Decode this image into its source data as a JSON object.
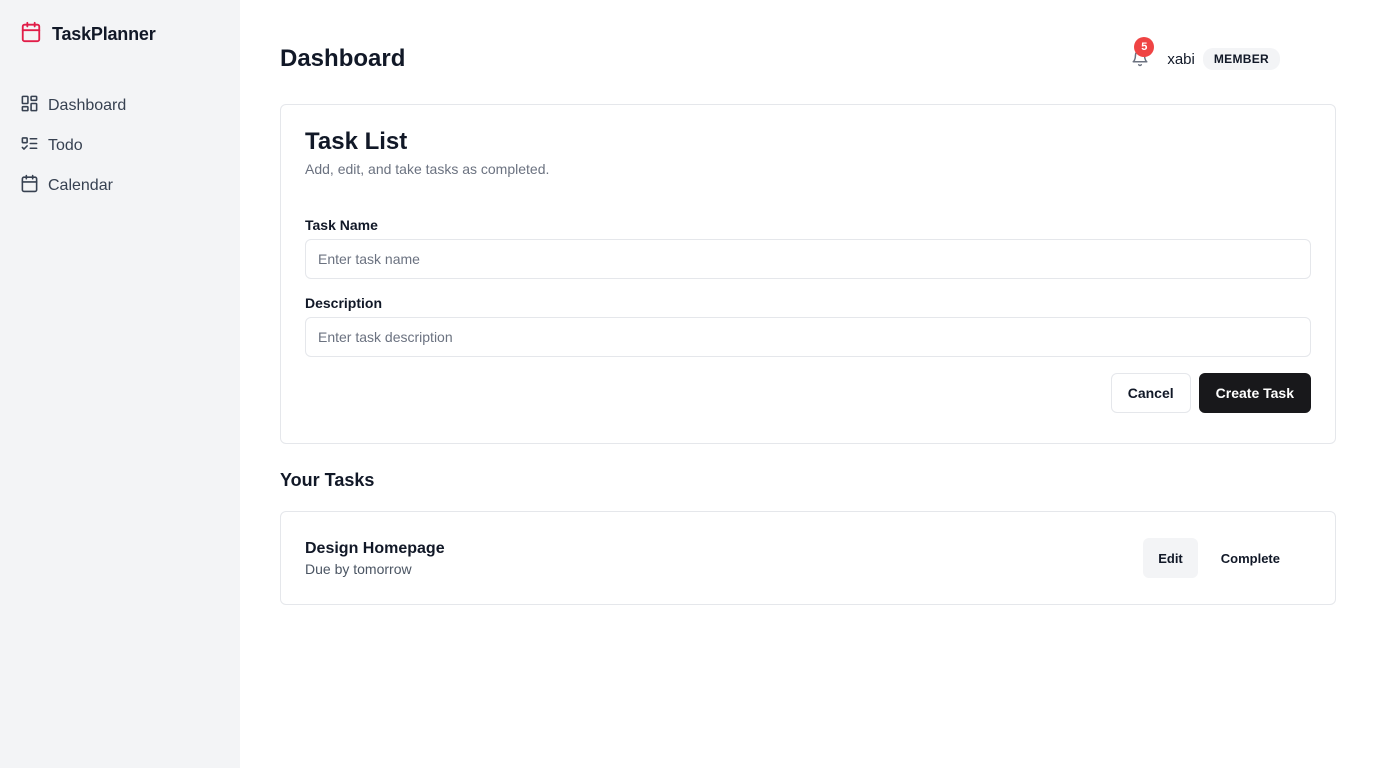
{
  "brand": {
    "name": "TaskPlanner",
    "icon": "calendar-icon",
    "color": "#e11d48"
  },
  "sidebar": {
    "items": [
      {
        "label": "Dashboard",
        "icon": "dashboard-grid-icon"
      },
      {
        "label": "Todo",
        "icon": "checklist-icon"
      },
      {
        "label": "Calendar",
        "icon": "calendar-icon"
      }
    ]
  },
  "header": {
    "title": "Dashboard",
    "notifications": {
      "count": "5",
      "icon": "bell-icon",
      "badge_color": "#ef4444"
    },
    "user": {
      "name": "xabi",
      "role": "MEMBER"
    }
  },
  "task_form": {
    "title": "Task List",
    "subtitle": "Add, edit, and take tasks as completed.",
    "name_label": "Task Name",
    "name_placeholder": "Enter task name",
    "name_value": "",
    "description_label": "Description",
    "description_placeholder": "Enter task description",
    "description_value": "",
    "cancel_label": "Cancel",
    "create_label": "Create Task"
  },
  "tasks_section": {
    "title": "Your Tasks",
    "tasks": [
      {
        "name": "Design Homepage",
        "due": "Due by tomorrow",
        "edit_label": "Edit",
        "complete_label": "Complete"
      }
    ]
  }
}
